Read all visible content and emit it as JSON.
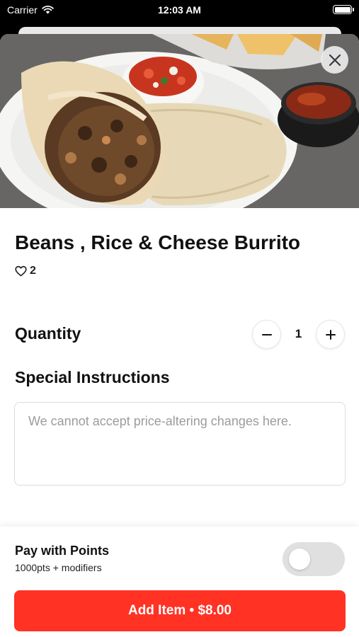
{
  "status_bar": {
    "carrier": "Carrier",
    "time": "12:03 AM"
  },
  "item": {
    "title": "Beans , Rice & Cheese Burrito",
    "likes": "2",
    "image": "burrito-photo"
  },
  "quantity": {
    "label": "Quantity",
    "value": "1"
  },
  "instructions": {
    "label": "Special Instructions",
    "placeholder": "We cannot accept price-altering changes here.",
    "value": ""
  },
  "points": {
    "title": "Pay with Points",
    "subtitle": "1000pts + modifiers",
    "enabled": false
  },
  "add_button": {
    "label": "Add Item • $8.00"
  },
  "colors": {
    "accent": "#ff3224",
    "toggle_off": "#e0e0e0"
  }
}
